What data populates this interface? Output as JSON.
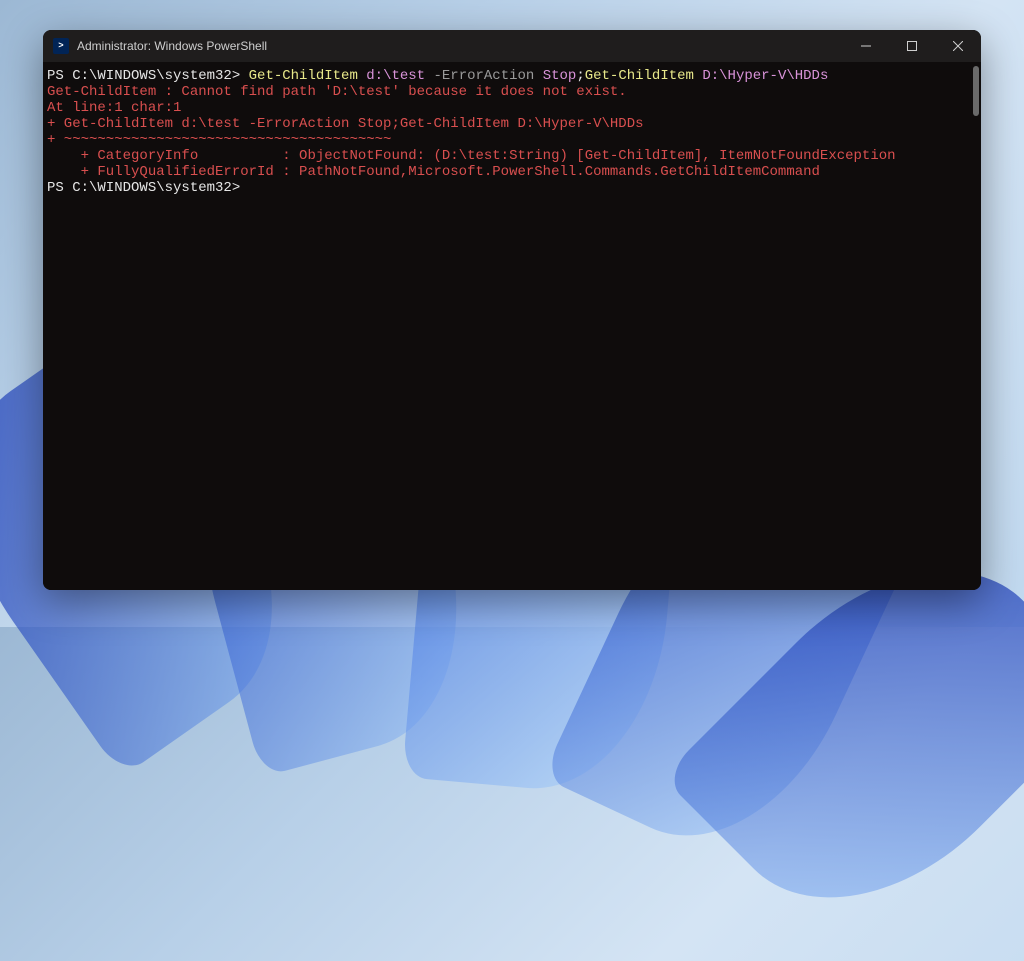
{
  "window": {
    "title": "Administrator: Windows PowerShell"
  },
  "terminal": {
    "line1": {
      "prompt": "PS C:\\WINDOWS\\system32> ",
      "seg1": "Get-ChildItem ",
      "seg2": "d:\\test ",
      "seg3": "-ErrorAction ",
      "seg4": "Stop",
      "seg5": ";",
      "seg6": "Get-ChildItem ",
      "seg7": "D:\\Hyper-V\\HDDs"
    },
    "err1": "Get-ChildItem : Cannot find path 'D:\\test' because it does not exist.",
    "err2": "At line:1 char:1",
    "err3": "+ Get-ChildItem d:\\test -ErrorAction Stop;Get-ChildItem D:\\Hyper-V\\HDDs",
    "err4": "+ ~~~~~~~~~~~~~~~~~~~~~~~~~~~~~~~~~~~~~~~",
    "err5": "    + CategoryInfo          : ObjectNotFound: (D:\\test:String) [Get-ChildItem], ItemNotFoundException",
    "err6": "    + FullyQualifiedErrorId : PathNotFound,Microsoft.PowerShell.Commands.GetChildItemCommand",
    "blank": "",
    "prompt2": "PS C:\\WINDOWS\\system32>"
  }
}
